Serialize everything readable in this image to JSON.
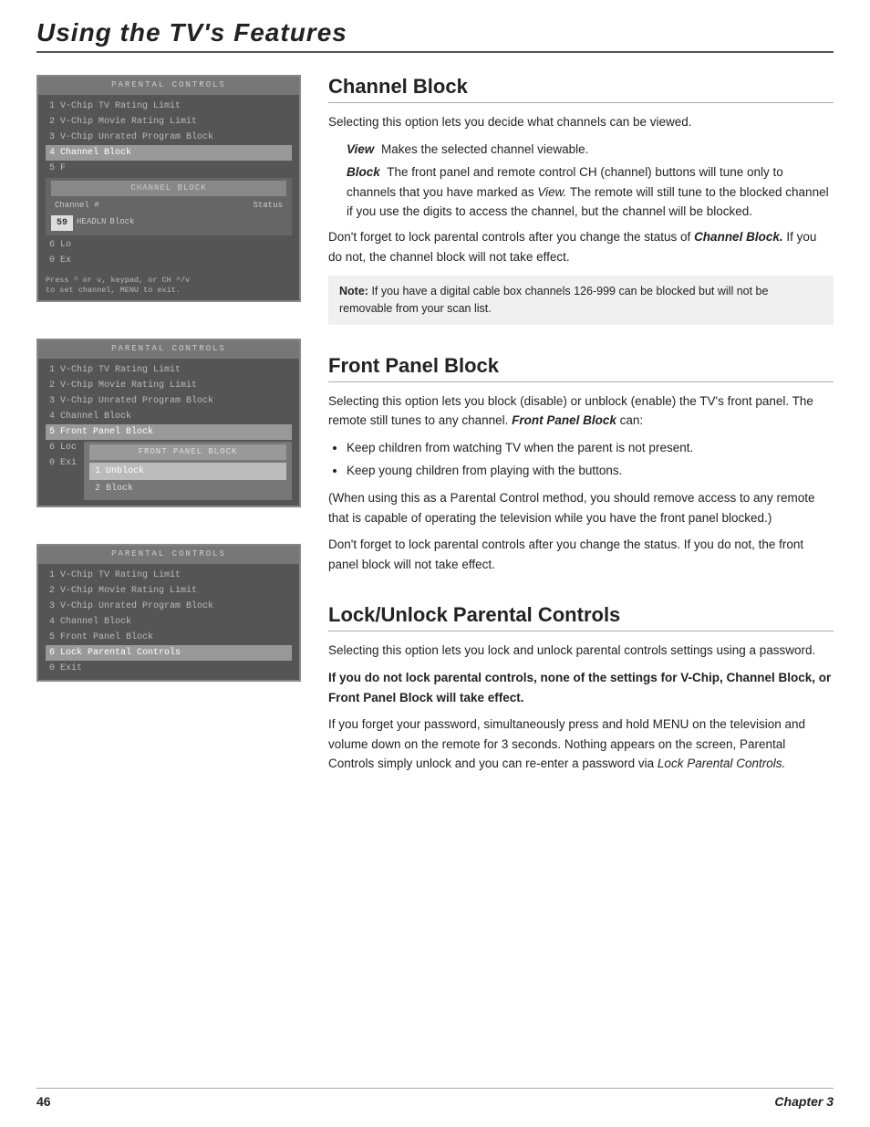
{
  "header": {
    "title": "Using the TV's Features"
  },
  "menu1": {
    "header": "PARENTAL  CONTROLS",
    "items": [
      "1 V-Chip TV Rating Limit",
      "2 V-Chip Movie Rating Limit",
      "3 V-Chip Unrated Program Block",
      "4 Channel Block",
      "5 F",
      "6 Lo",
      "0 Ex"
    ],
    "submenu_header": "CHANNEL BLOCK",
    "col1": "Channel #",
    "col2": "Status",
    "channel_num": "59",
    "channel_name": "HEADLN",
    "channel_status": "Block",
    "note": "Press ^ or v, keypad, or CH ^/v\nto set channel, MENU to exit."
  },
  "menu2": {
    "header": "PARENTAL  CONTROLS",
    "items": [
      "1 V-Chip TV Rating Limit",
      "2 V-Chip Movie Rating Limit",
      "3 V-Chip Unrated Program Block",
      "4 Channel Block",
      "5 Front Panel Block",
      "6 Loc",
      "0 Exi"
    ],
    "submenu_header": "FRONT PANEL BLOCK",
    "option1": "1 Unblock",
    "option2": "2 Block"
  },
  "menu3": {
    "header": "PARENTAL  CONTROLS",
    "items": [
      "1 V-Chip TV Rating Limit",
      "2 V-Chip Movie Rating Limit",
      "3 V-Chip Unrated Program Block",
      "4 Channel Block",
      "5 Front Panel Block",
      "6 Lock Parental Controls",
      "0 Exit"
    ]
  },
  "section1": {
    "title": "Channel Block",
    "intro": "Selecting this option lets you decide what channels can be viewed.",
    "view_label": "View",
    "view_text": "Makes the selected channel viewable.",
    "block_label": "Block",
    "block_text": "The front panel and remote control CH (channel) buttons will tune only to channels that you have marked as View. The remote will still tune to the blocked channel if you use the digits to access the channel, but the channel will be blocked.",
    "block_text_italic": "View.",
    "reminder": "Don't forget to lock parental controls after you change the status of Channel Block. If you do not, the channel block will not take effect.",
    "reminder_italic": "Channel Block.",
    "note_label": "Note:",
    "note_text": "If you have a digital cable box channels 126-999 can be blocked but will not be removable from your scan list."
  },
  "section2": {
    "title": "Front Panel Block",
    "intro": "Selecting this option lets you block (disable) or unblock (enable) the TV's front panel. The remote still tunes to any channel.",
    "intro_italic": "Front Panel Block",
    "intro_suffix": "can:",
    "bullet1": "Keep children from watching TV when the parent is not present.",
    "bullet2": "Keep young children from playing with the buttons.",
    "paren_text": "(When using this as a Parental Control method, you should remove access to any remote that is capable of operating the television while you have the front panel blocked.)",
    "reminder": "Don't forget to lock parental controls after you change the status. If you do not, the front panel block will not take effect."
  },
  "section3": {
    "title": "Lock/Unlock Parental Controls",
    "intro": "Selecting this option lets you lock and unlock parental controls settings using a password.",
    "bold_warning": "If you do not lock parental controls, none of the settings for V-Chip, Channel Block, or Front Panel Block will take effect.",
    "body": "If you forget your password, simultaneously press and hold MENU on the television and volume down on the remote for 3 seconds. Nothing appears on the screen, Parental Controls simply unlock and you can re-enter a password via Lock Parental Controls.",
    "body_italic": "Lock Parental Controls."
  },
  "footer": {
    "page_num": "46",
    "chapter": "Chapter 3"
  }
}
